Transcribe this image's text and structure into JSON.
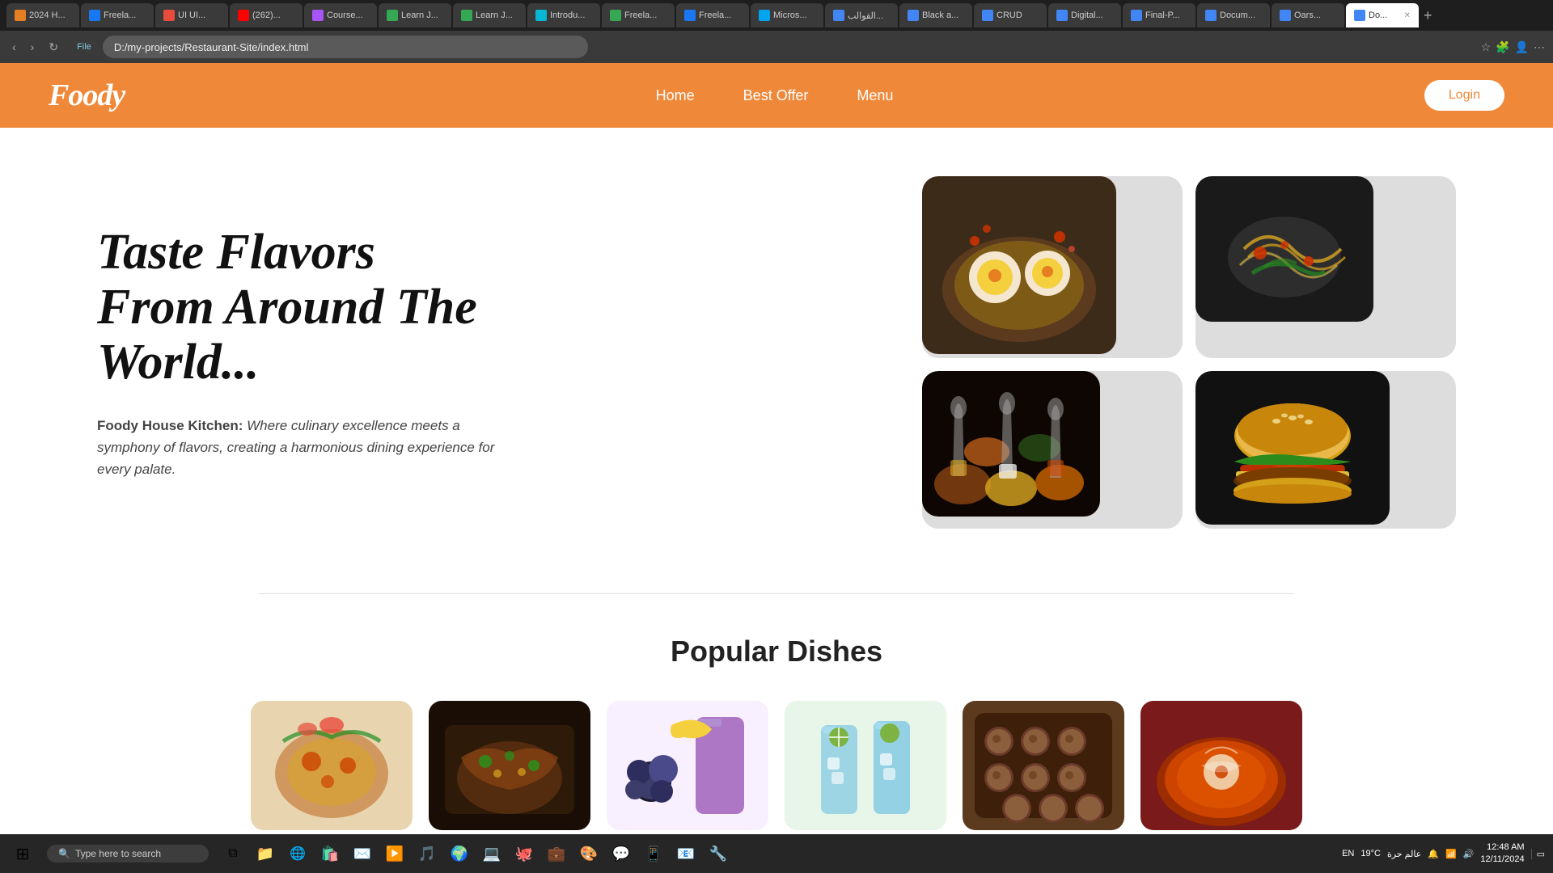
{
  "browser": {
    "tabs": [
      {
        "label": "2024 H...",
        "favicon_color": "#4285F4",
        "active": false
      },
      {
        "label": "Freela...",
        "favicon_color": "#1877F2",
        "active": false
      },
      {
        "label": "UI UI ...",
        "favicon_color": "#e74c3c",
        "active": false
      },
      {
        "label": "(262) ...",
        "favicon_color": "#FF0000",
        "active": false
      },
      {
        "label": "Course...",
        "favicon_color": "#a855f7",
        "active": false
      },
      {
        "label": "Learn J...",
        "favicon_color": "#34A853",
        "active": false
      },
      {
        "label": "Learn J...",
        "favicon_color": "#34A853",
        "active": false
      },
      {
        "label": "Introdu...",
        "favicon_color": "#06b6d4",
        "active": false
      },
      {
        "label": "Freela...",
        "favicon_color": "#34A853",
        "active": false
      },
      {
        "label": "Freela...",
        "favicon_color": "#1877F2",
        "active": false
      },
      {
        "label": "Micros...",
        "favicon_color": "#00a4ef",
        "active": false
      },
      {
        "label": "القوالب...",
        "favicon_color": "#4285F4",
        "active": false
      },
      {
        "label": "Black a...",
        "favicon_color": "#4285F4",
        "active": false
      },
      {
        "label": "CRUD",
        "favicon_color": "#4285F4",
        "active": false
      },
      {
        "label": "Digital...",
        "favicon_color": "#4285F4",
        "active": false
      },
      {
        "label": "Final-P...",
        "favicon_color": "#4285F4",
        "active": false
      },
      {
        "label": "Docum...",
        "favicon_color": "#4285F4",
        "active": false
      },
      {
        "label": "Oars...",
        "favicon_color": "#4285F4",
        "active": false
      },
      {
        "label": "Do...",
        "favicon_color": "#4285F4",
        "active": true
      }
    ],
    "address": "D:/my-projects/Restaurant-Site/index.html",
    "address_prefix": "File"
  },
  "navbar": {
    "logo": "Foody",
    "nav_links": [
      "Home",
      "Best Offer",
      "Menu"
    ],
    "login_btn": "Login"
  },
  "hero": {
    "title": "Taste Flavors From Around The World...",
    "subtitle_brand": "Foody House Kitchen:",
    "subtitle_text": " Where culinary excellence meets a symphony of flavors, creating a harmonious dining experience for every palate."
  },
  "popular": {
    "title": "Popular Dishes"
  },
  "taskbar": {
    "search_placeholder": "Type here to search",
    "time": "12:48 AM",
    "date": "12/11/2024",
    "language": "EN",
    "temperature": "19°C",
    "location": "عالم حرة"
  }
}
